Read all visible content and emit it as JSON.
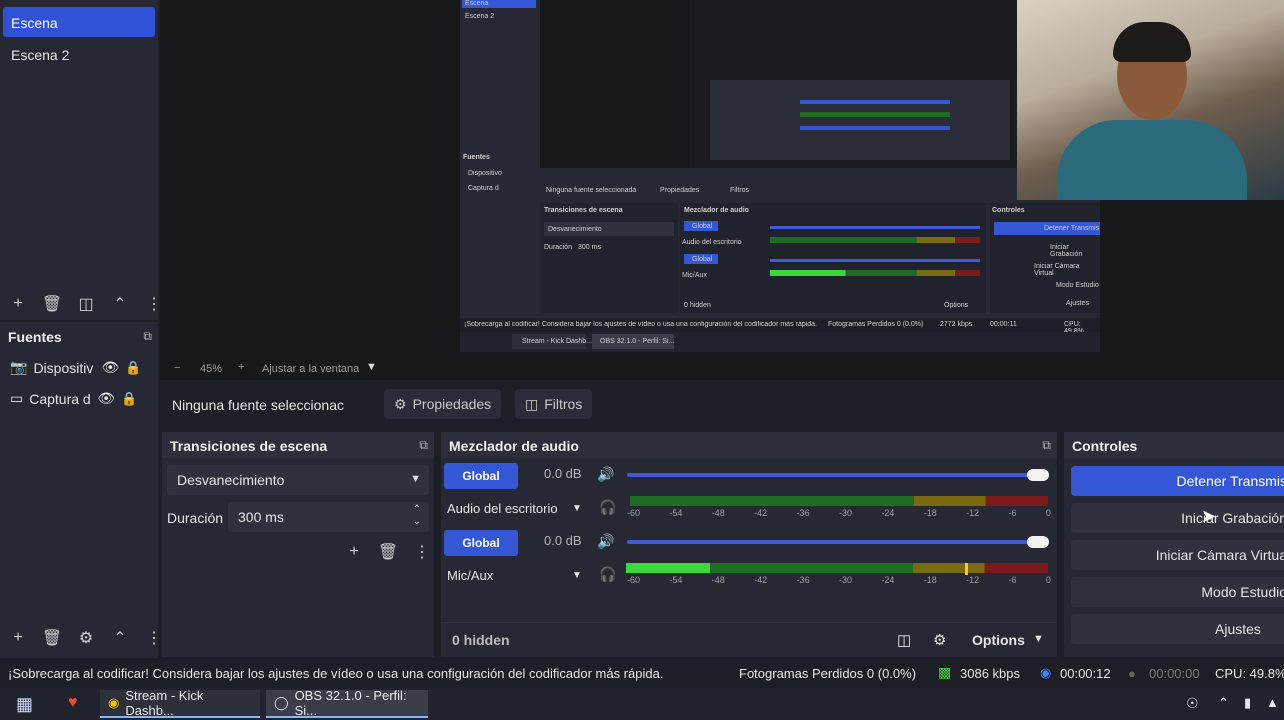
{
  "scenes": {
    "items": [
      {
        "label": "Escena",
        "active": true
      },
      {
        "label": "Escena 2",
        "active": false
      }
    ]
  },
  "sources": {
    "title": "Fuentes",
    "items": [
      {
        "label": "Dispositiv",
        "icon": "camera-icon"
      },
      {
        "label": "Captura d",
        "icon": "monitor-icon"
      }
    ]
  },
  "preview": {
    "zoom": "45%",
    "fit_label": "Ajustar a la ventana",
    "inner": {
      "scene1": "Escena",
      "scene2": "Escena 2",
      "fuentes": "Fuentes",
      "src1": "Dispositivo",
      "src2": "Captura d",
      "no_source": "Ninguna fuente seleccionada",
      "props": "Propiedades",
      "filters": "Filtros",
      "transitions": "Transiciones de escena",
      "mixer": "Mezclador de audio",
      "controls": "Controles",
      "fade": "Desvanecimiento",
      "duration": "Duración",
      "duration_val": "300 ms",
      "global": "Global",
      "desktop_audio": "Audio del escritorio",
      "mic": "Mic/Aux",
      "stop": "Detener Transmis",
      "start_rec": "Iniciar Grabación",
      "virtual_cam": "Iniciar Cámara Virtual",
      "studio": "Modo Estudio",
      "settings": "Ajustes",
      "hidden": "0 hidden",
      "options": "Options",
      "warning": "¡Sobrecarga al codificar! Considera bajar los ajustes de vídeo o usa una configuración del codificador más rápida.",
      "dropped": "Fotogramas Perdidos 0 (0.0%)",
      "kbps": "2772 kbps",
      "time": "00:00:11",
      "cpu": "CPU: 49.8%",
      "task1": "Stream - Kick Dashb...",
      "task2": "OBS 32.1.0 - Perfil: Si..."
    }
  },
  "context": {
    "no_source": "Ninguna fuente seleccionac",
    "properties": "Propiedades",
    "filters": "Filtros"
  },
  "transitions": {
    "title": "Transiciones de escena",
    "selected": "Desvanecimiento",
    "duration_label": "Duración",
    "duration_value": "300 ms"
  },
  "mixer": {
    "title": "Mezclador de audio",
    "channels": [
      {
        "global": "Global",
        "db": "0.0 dB",
        "name": "Audio del escritorio",
        "level": 0.0
      },
      {
        "global": "Global",
        "db": "0.0 dB",
        "name": "Mic/Aux",
        "level": 0.2
      }
    ],
    "ticks": [
      "-60",
      "-54",
      "-48",
      "-42",
      "-36",
      "-30",
      "-24",
      "-18",
      "-12",
      "-6",
      "0"
    ],
    "hidden": "0 hidden",
    "options": "Options"
  },
  "controls": {
    "title": "Controles",
    "stop_stream": "Detener Transmis",
    "start_recording": "Iniciar Grabación",
    "virtual_camera": "Iniciar Cámara Virtua",
    "studio_mode": "Modo Estudio",
    "settings": "Ajustes"
  },
  "status": {
    "warning": "¡Sobrecarga al codificar! Considera bajar los ajustes de vídeo o usa una configuración del codificador más rápida.",
    "dropped": "Fotogramas Perdidos 0 (0.0%)",
    "bitrate": "3086 kbps",
    "stream_time": "00:00:12",
    "rec_time": "00:00:00",
    "cpu": "CPU: 49.8%"
  },
  "taskbar": {
    "items": [
      {
        "label": "Stream - Kick Dashb..."
      },
      {
        "label": "OBS 32.1.0 - Perfil: Si..."
      }
    ]
  },
  "colors": {
    "accent": "#3557d6",
    "panel": "#262933",
    "background": "#1d1f26"
  }
}
